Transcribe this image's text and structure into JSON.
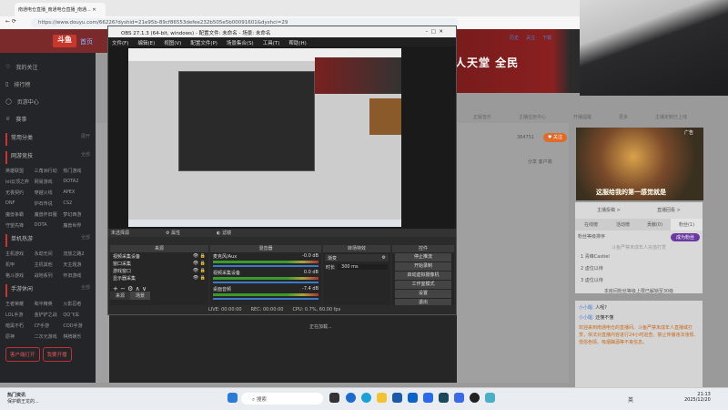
{
  "browser": {
    "tab_title": "南通电仓直播_南通电仓直播_南通...",
    "url": "https://www.douyu.com/66226?dyshid=21e95b-89cf86553defee232b505e5b00091601&dyshci=29",
    "toolbar": [
      "历史",
      "关注",
      "下载"
    ]
  },
  "site": {
    "logo": "斗鱼",
    "home": "首页",
    "banner": "人天堂 全民"
  },
  "sidebar": {
    "items": [
      "我的关注",
      "排行榜",
      "页游中心",
      "赛事"
    ],
    "sections": [
      {
        "title": "常用分类",
        "more": "展开",
        "items": []
      },
      {
        "title": "网游竞技",
        "more": "全部",
        "items": [
          "英雄联盟",
          "三角洲行动",
          "热门游戏",
          "lol云顶之弈",
          "网易游戏",
          "DOTA2",
          "无畏契约",
          "穿越火线",
          "APEX",
          "DNF",
          "炉石传说",
          "CS2",
          "魔兽争霸",
          "魔兽怀旧服",
          "梦幻西游",
          "守望先锋",
          "DOTA",
          "魔兽世界"
        ]
      },
      {
        "title": "单机热游",
        "more": "全部",
        "items": [
          "主机游戏",
          "永劫无间",
          "流放之路2",
          "机甲",
          "主机其他",
          "天主题游",
          "格斗游戏",
          "战地系列",
          "怀旧游戏"
        ]
      },
      {
        "title": "手游休闲",
        "more": "全部",
        "items": [
          "王者荣耀",
          "和平精英",
          "火影忍者",
          "LOL手游",
          "金铲铲之战",
          "QQ飞车",
          "暗黑不朽",
          "CF手游",
          "COD手游",
          "原神",
          "二次元游戏",
          "棋牌娱乐"
        ]
      }
    ],
    "buttons": [
      "客户端打开",
      "我要开播"
    ]
  },
  "nav": [
    "正版音乐",
    "主播任务中心",
    "开播提醒",
    "更多",
    "主播定制已上线"
  ],
  "room": {
    "fans": "384751",
    "follow": "关注",
    "share": "分享",
    "client": "客户端",
    "ad_text": "这服给我的第一感觉就是",
    "ad_label": "广告"
  },
  "rank": {
    "links": [
      "主播投稿 >",
      "直播回看 >"
    ],
    "tabs": [
      "在线榜",
      "活动榜",
      "贡献(0)",
      "粉丝(1)"
    ],
    "sort_label": "粉丝等级排序",
    "badge": "成为粉丝",
    "hint": "斗鱼严禁未成年人充值打赏",
    "rows": [
      {
        "n": "1",
        "name": "青峰Castiel"
      },
      {
        "n": "2",
        "name": "虚位以待"
      },
      {
        "n": "3",
        "name": "虚位以待"
      }
    ],
    "footer": "本房间粉丝等级上限已解锁至30级"
  },
  "chat": {
    "messages": [
      {
        "user": "小小醒:",
        "text": "人呢?"
      },
      {
        "user": "小小醒:",
        "text": "还懂不懂"
      }
    ],
    "notice": "欢迎来到南通电仓的直播间。斗鱼严禁未成年人直播或打赏，依法对直播内容进行24小时巡查。禁止传播违法违规、低俗色情、吸烟酗酒等不良信息。"
  },
  "obs": {
    "title": "OBS 27.1.3 (64-bit, windows) - 配置文件: 未命名 - 场景: 未命名",
    "menu": [
      "文件(F)",
      "编辑(E)",
      "视图(V)",
      "配置文件(P)",
      "场景集合(S)",
      "工具(T)",
      "帮助(H)"
    ],
    "no_source": "未选择源",
    "props": "属性",
    "filters": "滤镜",
    "sources_title": "来源",
    "sources": [
      "视频采集设备",
      "窗口采集",
      "游戏窗口",
      "显示器采集"
    ],
    "tabs": [
      "来源",
      "场景"
    ],
    "mixer_title": "混音器",
    "mixer": [
      {
        "name": "麦克风/Aux",
        "db": "-0.0 dB"
      },
      {
        "name": "视频采集设备",
        "db": "0.0 dB"
      },
      {
        "name": "桌面音频",
        "db": "-7.4 dB"
      }
    ],
    "transition_title": "转场特效",
    "transition": "渐变",
    "duration_label": "时长",
    "duration": "300 ms",
    "controls_title": "控件",
    "controls": [
      "停止推流",
      "开始录制",
      "启动虚拟摄像机",
      "工作室模式",
      "设置",
      "退出"
    ],
    "status": {
      "live": "LIVE: 00:00:00",
      "rec": "REC: 00:00:00",
      "cpu": "CPU: 0.7%, 60.00 fps"
    },
    "loading": "正在加载..."
  },
  "taskbar": {
    "search": "搜索",
    "notif_title": "热门资讯",
    "notif_text": "保护霸王龙的...",
    "ime": "英",
    "time": "21:13",
    "date": "2025/12/20"
  }
}
